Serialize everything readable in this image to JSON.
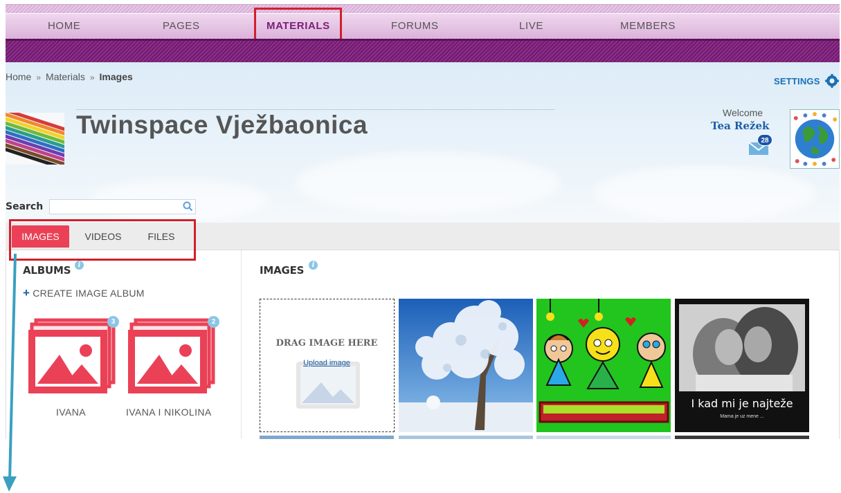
{
  "nav": {
    "items": [
      {
        "label": "HOME",
        "active": false
      },
      {
        "label": "PAGES",
        "active": false
      },
      {
        "label": "MATERIALS",
        "active": true
      },
      {
        "label": "FORUMS",
        "active": false
      },
      {
        "label": "LIVE",
        "active": false
      },
      {
        "label": "MEMBERS",
        "active": false
      }
    ]
  },
  "breadcrumb": {
    "items": [
      "Home",
      "Materials"
    ],
    "separator": "»",
    "current": "Images"
  },
  "header": {
    "settings_label": "SETTINGS",
    "title": "Twinspace Vježbaonica",
    "welcome": "Welcome",
    "username": "Tea Režek",
    "message_count": "28"
  },
  "search": {
    "label": "Search",
    "value": ""
  },
  "tabs": [
    {
      "label": "IMAGES",
      "active": true
    },
    {
      "label": "VIDEOS",
      "active": false
    },
    {
      "label": "FILES",
      "active": false
    }
  ],
  "albums": {
    "title": "ALBUMS",
    "create_label": "CREATE IMAGE ALBUM",
    "items": [
      {
        "label": "IVANA",
        "count": "3"
      },
      {
        "label": "IVANA I NIKOLINA",
        "count": "2"
      }
    ]
  },
  "images": {
    "title": "IMAGES",
    "drop_text": "DRAG IMAGE HERE",
    "upload_label": "Upload image",
    "thumb_caption": "I kad mi je najteže",
    "thumb_subcaption": "Mama je uz mene ..."
  },
  "colors": {
    "accent": "#ea4156",
    "nav_band": "#7a1e77",
    "link": "#1a5ea8",
    "highlight_box": "#d0202c",
    "arrow": "#3aa0c0"
  }
}
